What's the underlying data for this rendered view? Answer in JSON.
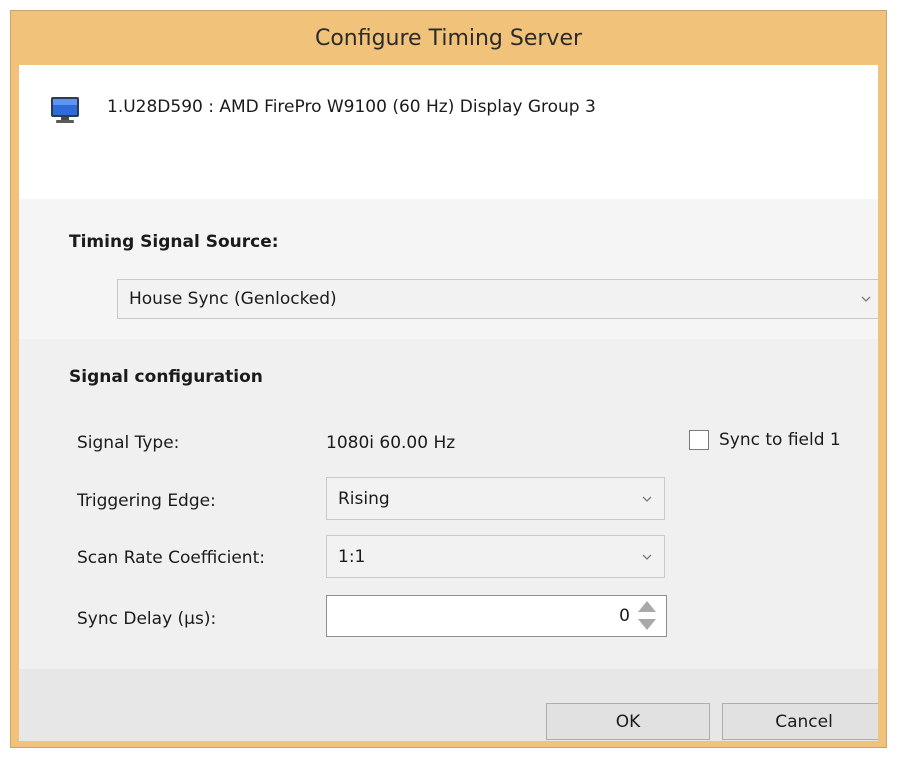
{
  "window": {
    "title": "Configure Timing Server"
  },
  "display": {
    "icon": "monitor-icon",
    "label": "1.U28D590 : AMD FirePro W9100 (60 Hz) Display Group 3"
  },
  "timing_source": {
    "title": "Timing Signal Source:",
    "selected": "House Sync (Genlocked)"
  },
  "signal_config": {
    "title": "Signal configuration",
    "signal_type_label": "Signal Type:",
    "signal_type_value": "1080i 60.00 Hz",
    "sync_to_field_label": "Sync to field 1",
    "sync_to_field_checked": false,
    "triggering_edge_label": "Triggering Edge:",
    "triggering_edge_value": "Rising",
    "scan_rate_label": "Scan Rate Coefficient:",
    "scan_rate_value": "1:1",
    "sync_delay_label": "Sync Delay (µs):",
    "sync_delay_value": "0"
  },
  "buttons": {
    "ok": "OK",
    "cancel": "Cancel"
  },
  "colors": {
    "title_bar": "#f0c27a",
    "header_bg": "#ffffff",
    "section_bg": "#f0f0f0",
    "button_bar_bg": "#e7e7e7"
  }
}
